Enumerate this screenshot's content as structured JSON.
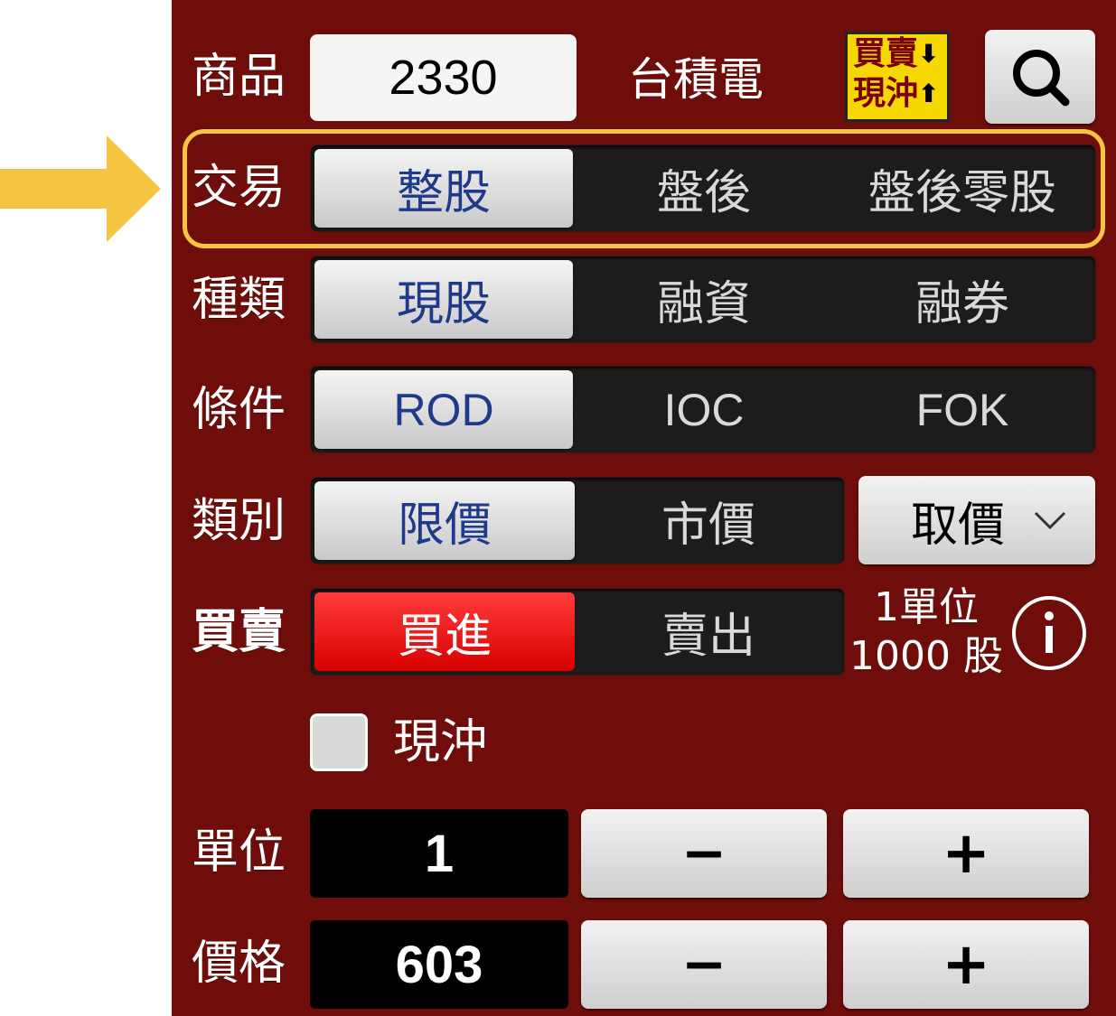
{
  "product": {
    "label": "商品",
    "code": "2330",
    "name": "台積電",
    "mode_badge_line1": "買賣",
    "mode_badge_line2": "現沖"
  },
  "trade": {
    "label": "交易",
    "options": [
      "整股",
      "盤後",
      "盤後零股"
    ],
    "selected": "整股"
  },
  "kind": {
    "label": "種類",
    "options": [
      "現股",
      "融資",
      "融券"
    ],
    "selected": "現股"
  },
  "condition": {
    "label": "條件",
    "options": [
      "ROD",
      "IOC",
      "FOK"
    ],
    "selected": "ROD"
  },
  "category": {
    "label": "類別",
    "options": [
      "限價",
      "市價"
    ],
    "selected": "限價",
    "price_dropdown": "取價"
  },
  "side": {
    "label": "買賣",
    "options": [
      "買進",
      "賣出"
    ],
    "selected": "買進",
    "unit_info_line1": "1單位",
    "unit_info_line2": "1000 股"
  },
  "day_trade": {
    "label": "現沖",
    "checked": false
  },
  "unit": {
    "label": "單位",
    "value": "1",
    "minus": "−",
    "plus": "+"
  },
  "price": {
    "label": "價格",
    "value": "603",
    "minus": "−",
    "plus": "+"
  },
  "colors": {
    "panel": "#6e0d09",
    "highlight": "#f5c542",
    "selected_text": "#1f3a8a",
    "buy": "#e60000"
  }
}
